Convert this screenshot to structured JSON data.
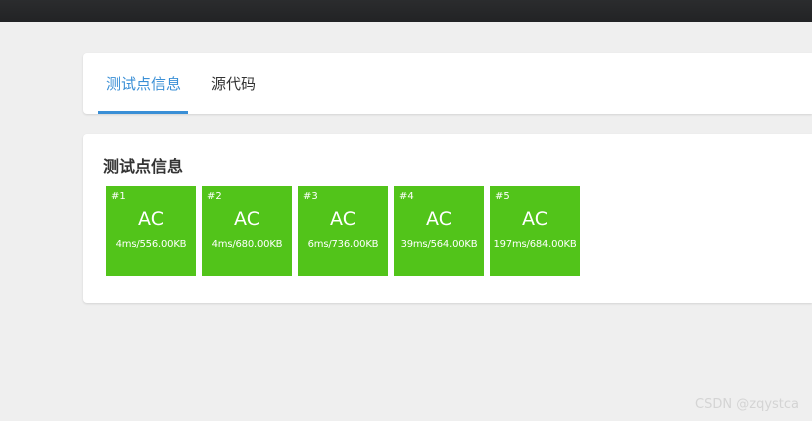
{
  "tabs": [
    {
      "label": "测试点信息",
      "active": true
    },
    {
      "label": "源代码",
      "active": false
    }
  ],
  "section_title": "测试点信息",
  "status_color": "#52c41a",
  "accent_color": "#3a8fd6",
  "test_cases": [
    {
      "id": "#1",
      "status": "AC",
      "detail": "4ms/556.00KB"
    },
    {
      "id": "#2",
      "status": "AC",
      "detail": "4ms/680.00KB"
    },
    {
      "id": "#3",
      "status": "AC",
      "detail": "6ms/736.00KB"
    },
    {
      "id": "#4",
      "status": "AC",
      "detail": "39ms/564.00KB"
    },
    {
      "id": "#5",
      "status": "AC",
      "detail": "197ms/684.00KB"
    }
  ],
  "watermark": "CSDN @zqystca"
}
